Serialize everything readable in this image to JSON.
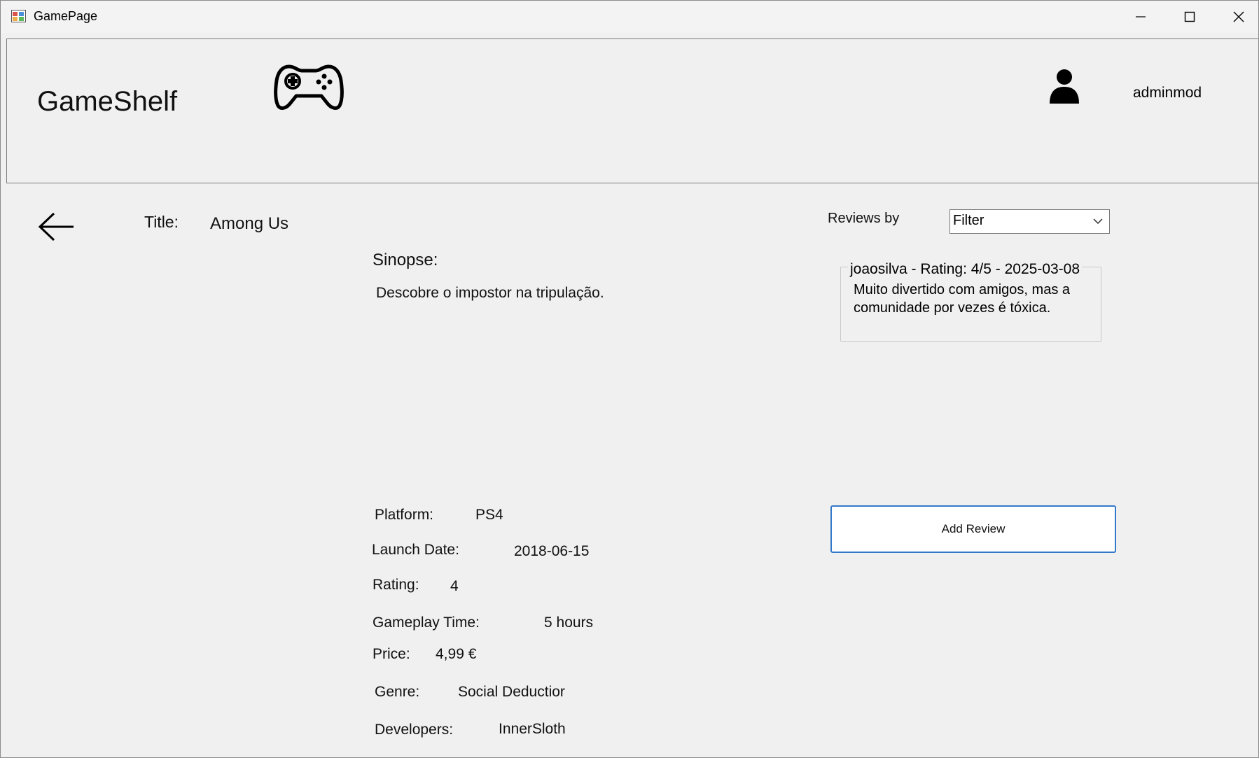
{
  "window": {
    "title": "GamePage"
  },
  "header": {
    "brand": "GameShelf",
    "username": "adminmod"
  },
  "game": {
    "title_label": "Title:",
    "title_value": "Among Us",
    "synopsis_label": "Sinopse:",
    "synopsis_value": "Descobre o impostor na tripulação.",
    "platform_label": "Platform:",
    "platform_value": "PS4",
    "launch_date_label": "Launch Date:",
    "launch_date_value": "2018-06-15",
    "rating_label": "Rating:",
    "rating_value": "4",
    "gameplay_time_label": "Gameplay Time:",
    "gameplay_time_value": "5 hours",
    "price_label": "Price:",
    "price_value": "4,99 €",
    "genre_label": "Genre:",
    "genre_value": "Social Deductior",
    "developers_label": "Developers:",
    "developers_value": "InnerSloth"
  },
  "reviews": {
    "label": "Reviews by",
    "filter_selected": "Filter",
    "items": [
      {
        "header": "joaosilva - Rating: 4/5 - 2025-03-08",
        "text": "Muito divertido com amigos, mas a comunidade por vezes é tóxica."
      }
    ],
    "add_button": "Add Review"
  },
  "icons": {
    "app": "app-window-icon",
    "controller": "gamepad-icon",
    "user": "user-icon",
    "back": "back-arrow-icon"
  }
}
